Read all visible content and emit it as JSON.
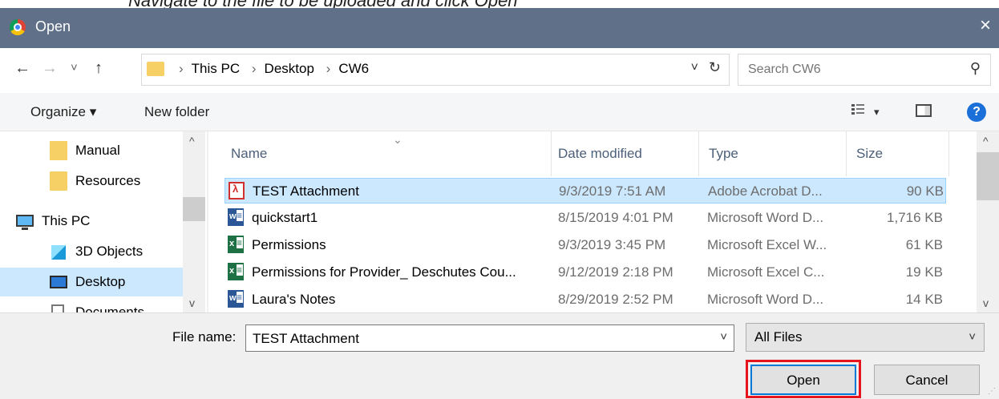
{
  "caption": "Navigate to the file to be uploaded and click Open",
  "window": {
    "title": "Open",
    "close_label": "×"
  },
  "nav": {
    "back": "←",
    "forward": "→",
    "recent": "˅",
    "up": "↑",
    "breadcrumbs": [
      "This PC",
      "Desktop",
      "CW6"
    ],
    "separator": "›",
    "dropdown": "˅",
    "refresh": "↻"
  },
  "search": {
    "placeholder": "Search CW6",
    "icon": "search-icon"
  },
  "toolbar": {
    "organize": "Organize ▾",
    "new_folder": "New folder",
    "view_dd": "▾",
    "help": "?"
  },
  "sidebar": {
    "items": [
      {
        "label": "Manual",
        "icon": "folder-icon"
      },
      {
        "label": "Resources",
        "icon": "folder-icon"
      },
      {
        "label": "This PC",
        "icon": "computer-icon"
      },
      {
        "label": "3D Objects",
        "icon": "cube-icon"
      },
      {
        "label": "Desktop",
        "icon": "desktop-icon",
        "selected": true
      },
      {
        "label": "Documents",
        "icon": "documents-icon"
      }
    ]
  },
  "columns": [
    "Name",
    "Date modified",
    "Type",
    "Size"
  ],
  "files": [
    {
      "name": "TEST Attachment",
      "date": "9/3/2019 7:51 AM",
      "type": "Adobe Acrobat D...",
      "size": "90 KB",
      "icon": "pdf-icon",
      "selected": true
    },
    {
      "name": "quickstart1",
      "date": "8/15/2019 4:01 PM",
      "type": "Microsoft Word D...",
      "size": "1,716 KB",
      "icon": "word-icon"
    },
    {
      "name": "Permissions",
      "date": "9/3/2019 3:45 PM",
      "type": "Microsoft Excel W...",
      "size": "61 KB",
      "icon": "excel-icon"
    },
    {
      "name": "Permissions for Provider_ Deschutes Cou...",
      "date": "9/12/2019 2:18 PM",
      "type": "Microsoft Excel C...",
      "size": "19 KB",
      "icon": "excel-icon"
    },
    {
      "name": "Laura's Notes",
      "date": "8/29/2019 2:52 PM",
      "type": "Microsoft Word D...",
      "size": "14 KB",
      "icon": "word-icon"
    }
  ],
  "bottom": {
    "file_name_label": "File name:",
    "file_name_value": "TEST Attachment",
    "filter": "All Files",
    "open": "Open",
    "cancel": "Cancel"
  },
  "colors": {
    "titlebar": "#5f7088",
    "selection": "#cce8ff",
    "highlight_box": "#e8141d",
    "primary_border": "#0078d7"
  }
}
